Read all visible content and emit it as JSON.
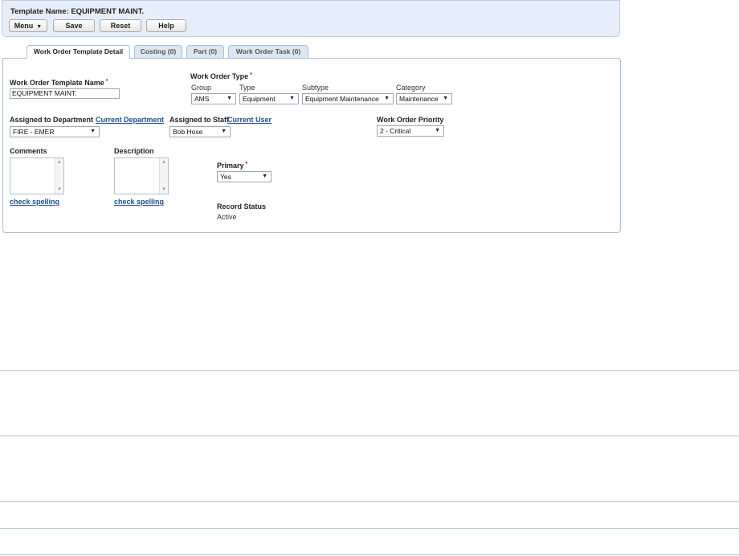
{
  "header": {
    "title": "Template Name: EQUIPMENT MAINT.",
    "buttons": {
      "menu": "Menu",
      "save": "Save",
      "reset": "Reset",
      "help": "Help"
    }
  },
  "tabs": [
    {
      "label": "Work Order Template Detail",
      "active": true
    },
    {
      "label": "Costing (0)"
    },
    {
      "label": "Part (0)"
    },
    {
      "label": "Work Order Task (0)"
    }
  ],
  "form": {
    "template_name": {
      "label": "Work Order Template Name",
      "value": "EQUIPMENT MAINT."
    },
    "work_order_type": {
      "label": "Work Order Type",
      "group": {
        "label": "Group",
        "value": "AMS"
      },
      "type": {
        "label": "Type",
        "value": "Equipment"
      },
      "subtype": {
        "label": "Subtype",
        "value": "Equipment Maintenance"
      },
      "category": {
        "label": "Category",
        "value": "Maintenance"
      }
    },
    "department": {
      "label": "Assigned to Department",
      "link": "Current Department",
      "value": "FIRE - EMER"
    },
    "staff": {
      "label": "Assigned to Staff",
      "link": "Current User",
      "value": "Bob Hose"
    },
    "priority": {
      "label": "Work Order Priority",
      "value": "2 - Critical"
    },
    "comments": {
      "label": "Comments",
      "spell": "check spelling"
    },
    "description": {
      "label": "Description",
      "spell": "check spelling"
    },
    "primary": {
      "label": "Primary",
      "value": "Yes"
    },
    "record_status": {
      "label": "Record Status",
      "value": "Active"
    }
  },
  "colors": {
    "header_bg": "#e6eff9",
    "border": "#a8c0dc",
    "link": "#1f4e8c",
    "required": "#cc0000"
  }
}
